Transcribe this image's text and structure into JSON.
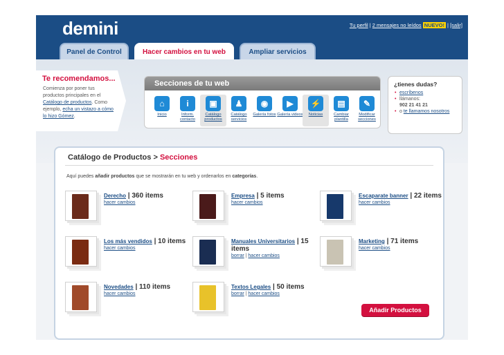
{
  "app": {
    "logo": "demini"
  },
  "userbar": {
    "profile": "Tu perfil",
    "sep1": " | ",
    "messages": "2 mensajes no leídos",
    "new_badge": "NUEVO!",
    "sep2": " | ",
    "logout": "[salir]"
  },
  "tabs": [
    {
      "label": "Panel de Control",
      "active": false
    },
    {
      "label": "Hacer cambios en tu web",
      "active": true
    },
    {
      "label": "Ampliar servicios",
      "active": false
    }
  ],
  "recommend": {
    "title": "Te recomendamos...",
    "text1": "Comienza por poner tus productos principales en el ",
    "link1": "Catálogo de productos",
    "text2": ". Como ejemplo, ",
    "link2": "echa un vistazo a cómo lo hizo Gómez",
    "text3": "."
  },
  "sections": {
    "title": "Secciones de tu web",
    "items": [
      {
        "icon": "home-icon",
        "glyph": "⌂",
        "label": "Inicio",
        "selected": false
      },
      {
        "icon": "info-icon",
        "glyph": "i",
        "label": "Inform. contacto",
        "selected": false
      },
      {
        "icon": "box-icon",
        "glyph": "▣",
        "label": "Catálogo productos",
        "selected": true
      },
      {
        "icon": "people-icon",
        "glyph": "♟",
        "label": "Catálogo servicios",
        "selected": false
      },
      {
        "icon": "camera-icon",
        "glyph": "◉",
        "label": "Galería fotos",
        "selected": false
      },
      {
        "icon": "film-icon",
        "glyph": "▶",
        "label": "Galería videos",
        "selected": false
      },
      {
        "icon": "broadcast-icon",
        "glyph": "⚡",
        "label": "Noticias",
        "selected": true
      },
      {
        "icon": "template-icon",
        "glyph": "▤",
        "label": "Cambiar plantilla",
        "selected": false
      },
      {
        "icon": "wrench-icon",
        "glyph": "✎",
        "label": "Modificar secciones",
        "selected": false
      }
    ]
  },
  "help": {
    "title": "¿tienes dudas?",
    "write": "escríbenos",
    "call": "llámanos:",
    "phone": "902 21 41 21",
    "or": "o ",
    "callback": "te llamamos nosotros"
  },
  "catalog": {
    "crumb_parent": "Catálogo de Productos",
    "crumb_sep": " > ",
    "crumb_current": "Secciones",
    "intro_1": "Aquí puedes ",
    "intro_b1": "añadir productos",
    "intro_2": " que se mostrarán en tu web y ordenarlos en ",
    "intro_b2": "categorías",
    "intro_3": ".",
    "action_edit": "hacer cambios",
    "action_delete": "borrar",
    "action_sep": " | ",
    "products": [
      {
        "name": "Derecho",
        "count": "| 360 items",
        "deletable": false,
        "book_color": "#6b2b1b"
      },
      {
        "name": "Empresa",
        "count": "| 5 items",
        "deletable": false,
        "book_color": "#4a1a1a"
      },
      {
        "name": "Escaparate banner",
        "count": "| 22 items",
        "deletable": false,
        "book_color": "#17396b"
      },
      {
        "name": "Los más vendidos",
        "count": "| 10 items",
        "deletable": false,
        "book_color": "#7a2b12"
      },
      {
        "name": "Manuales Universitarios",
        "count": "| 15 items",
        "deletable": true,
        "book_color": "#1a2d52"
      },
      {
        "name": "Marketing",
        "count": "| 71 items",
        "deletable": false,
        "book_color": "#c9c3b3"
      },
      {
        "name": "Novedades",
        "count": "| 110 items",
        "deletable": false,
        "book_color": "#a04a2a"
      },
      {
        "name": "Textos Legales",
        "count": "| 50 items",
        "deletable": true,
        "book_color": "#e8c22a"
      }
    ],
    "add_button": "Añadir Productos"
  }
}
